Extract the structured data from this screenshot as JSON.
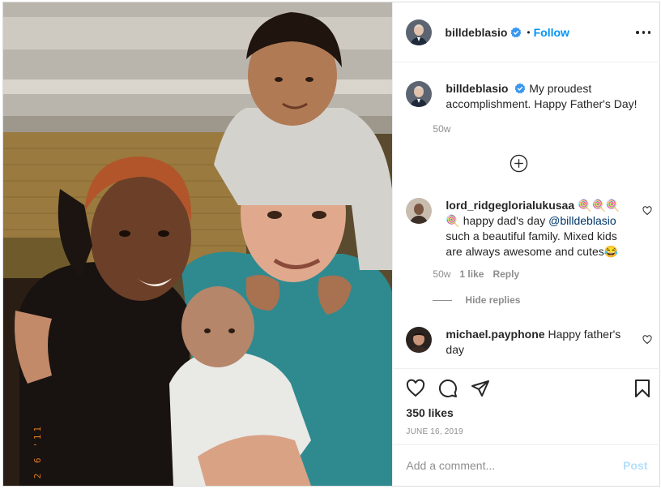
{
  "post": {
    "image_icon": "family-photo",
    "camera_date_stamp": "2 6 '11"
  },
  "header": {
    "username": "billdeblasio",
    "separator": "•",
    "follow_label": "Follow",
    "verified_icon": "verified-badge-icon",
    "more_icon": "more-options-icon"
  },
  "caption": {
    "username": "billdeblasio",
    "text": "My proudest accomplishment. Happy Father's Day!",
    "time": "50w"
  },
  "load_more_icon": "plus-circle-icon",
  "comments": [
    {
      "username": "lord_ridgeglorialukusaa",
      "emoji": "🍭🍭🍭🍭",
      "text_before": "happy dad's day ",
      "mention": "@billdeblasio",
      "text_after": " such a beautiful family. Mixed kids are always awesome and cutes😂",
      "time": "50w",
      "likes": "1 like",
      "reply": "Reply"
    },
    {
      "username": "michael.payphone",
      "text": "Happy father's day"
    }
  ],
  "hide_replies": "Hide replies",
  "actions": {
    "like_icon": "heart-icon",
    "comment_icon": "comment-icon",
    "share_icon": "paper-plane-icon",
    "save_icon": "bookmark-icon",
    "likes": "350 likes",
    "date": "JUNE 16, 2019"
  },
  "add_comment": {
    "placeholder": "Add a comment...",
    "post_label": "Post",
    "post_color": "#b2dffc"
  },
  "colors": {
    "accent": "#0095f6",
    "verified": "#3897f0",
    "mention": "#00376b",
    "muted": "#8e8e8e"
  }
}
